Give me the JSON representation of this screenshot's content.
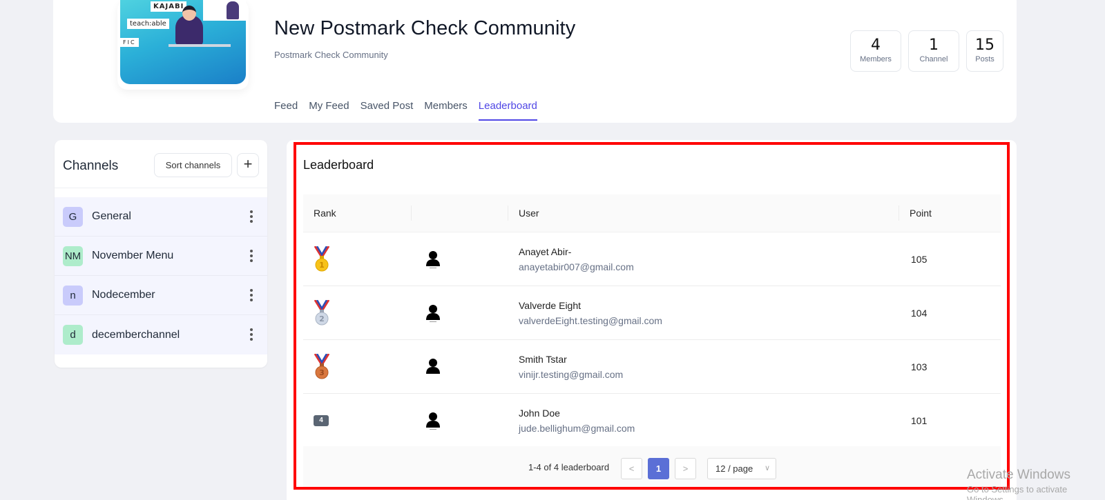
{
  "community": {
    "title": "New Postmark Check Community",
    "subtitle": "Postmark Check Community",
    "cover_tags": [
      "KAJABI",
      "teach:able",
      "FIC"
    ]
  },
  "stats": [
    {
      "value": "4",
      "label": "Members"
    },
    {
      "value": "1",
      "label": "Channel"
    },
    {
      "value": "15",
      "label": "Posts"
    }
  ],
  "tabs": [
    {
      "label": "Feed",
      "active": false
    },
    {
      "label": "My Feed",
      "active": false
    },
    {
      "label": "Saved Post",
      "active": false
    },
    {
      "label": "Members",
      "active": false
    },
    {
      "label": "Leaderboard",
      "active": true
    }
  ],
  "channels": {
    "title": "Channels",
    "sort_label": "Sort channels",
    "add_label": "+",
    "items": [
      {
        "initials": "G",
        "name": "General",
        "color": "#c9cbfb"
      },
      {
        "initials": "NM",
        "name": "November Menu",
        "color": "#aeeccb"
      },
      {
        "initials": "n",
        "name": "Nodecember",
        "color": "#c9cbfb"
      },
      {
        "initials": "d",
        "name": "decemberchannel",
        "color": "#aeeccb"
      }
    ]
  },
  "leaderboard": {
    "title": "Leaderboard",
    "columns": {
      "rank": "Rank",
      "avatar": "",
      "user": "User",
      "point": "Point"
    },
    "rows": [
      {
        "rank": "1",
        "medal": "gold-medal",
        "name": "Anayet Abir-",
        "email": "anayetabir007@gmail.com",
        "points": "105"
      },
      {
        "rank": "2",
        "medal": "silver-medal",
        "name": "Valverde Eight",
        "email": "valverdeEight.testing@gmail.com",
        "points": "104"
      },
      {
        "rank": "3",
        "medal": "bronze-medal",
        "name": "Smith Tstar",
        "email": "vinijr.testing@gmail.com",
        "points": "103"
      },
      {
        "rank": "4",
        "medal": "",
        "name": "John Doe",
        "email": "jude.bellighum@gmail.com",
        "points": "101"
      }
    ],
    "pagination": {
      "total_text": "1-4 of 4 leaderboard",
      "prev": "<",
      "current": "1",
      "next": ">",
      "page_size": "12 / page"
    }
  },
  "colors": {
    "accent": "#4f46e5",
    "highlight": "#ff0000",
    "page_active": "#5b6fd6"
  },
  "watermark": {
    "line1": "Activate Windows",
    "line2": "Go to Settings to activate Windows."
  }
}
